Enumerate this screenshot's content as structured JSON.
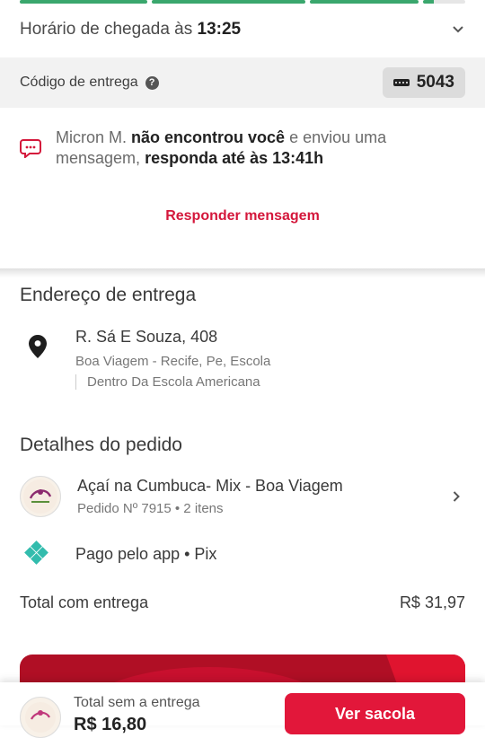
{
  "progress": {
    "steps": [
      1,
      1,
      1,
      0.3
    ]
  },
  "arrival": {
    "label": "Horário de chegada às",
    "time": "13:25"
  },
  "delivery_code": {
    "label": "Código de entrega",
    "code": "5043"
  },
  "message": {
    "driver": "Micron M.",
    "bold1": "não encontrou você",
    "mid": "e enviou uma mensagem,",
    "bold2": "responda até às 13:41h",
    "reply_label": "Responder mensagem"
  },
  "address": {
    "section_title": "Endereço de entrega",
    "street": "R. Sá E Souza, 408",
    "area": "Boa Viagem - Recife, Pe, Escola",
    "complement": "Dentro Da Escola Americana"
  },
  "order": {
    "section_title": "Detalhes do pedido",
    "store_name": "Açaí na Cumbuca- Mix - Boa Viagem",
    "order_info": "Pedido Nº 7915 • 2 itens",
    "payment": "Pago pelo app • Pix",
    "total_label": "Total com entrega",
    "total_value": "R$ 31,97"
  },
  "bottom": {
    "label": "Total sem a entrega",
    "price": "R$ 16,80",
    "button": "Ver sacola"
  },
  "colors": {
    "accent": "#e2173a",
    "progress": "#3aa76d",
    "pix": "#32bcad"
  }
}
